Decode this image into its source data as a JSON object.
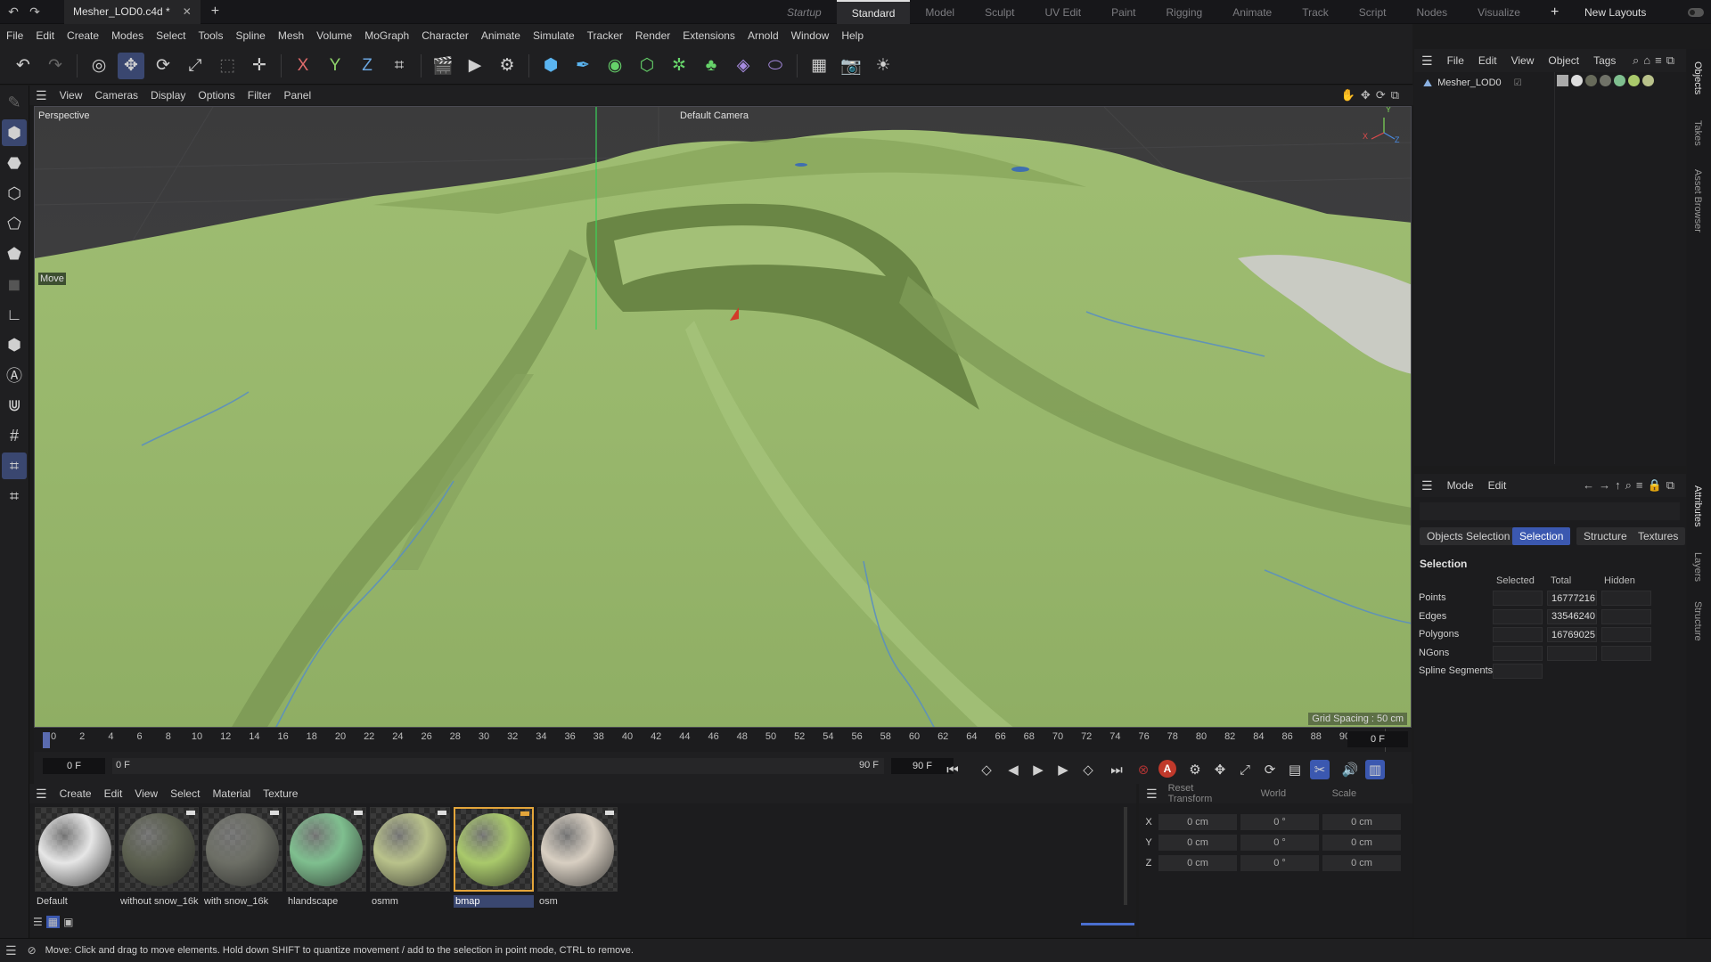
{
  "titlebar": {
    "document_tab": "Mesher_LOD0.c4d *",
    "layouts": [
      "Startup",
      "Standard",
      "Model",
      "Sculpt",
      "UV Edit",
      "Paint",
      "Rigging",
      "Animate",
      "Track",
      "Script",
      "Nodes",
      "Visualize"
    ],
    "active_layout": "Standard",
    "new_layouts": "New Layouts"
  },
  "menubar": [
    "File",
    "Edit",
    "Create",
    "Modes",
    "Select",
    "Tools",
    "Spline",
    "Mesh",
    "Volume",
    "MoGraph",
    "Character",
    "Animate",
    "Simulate",
    "Tracker",
    "Render",
    "Extensions",
    "Arnold",
    "Window",
    "Help"
  ],
  "toolbar": {
    "axis_x": "X",
    "axis_y": "Y",
    "axis_z": "Z"
  },
  "viewport": {
    "menu": [
      "View",
      "Cameras",
      "Display",
      "Options",
      "Filter",
      "Panel"
    ],
    "view_name": "Perspective",
    "camera": "Default Camera",
    "tool_label": "Move",
    "grid_spacing": "Grid Spacing : 50 cm",
    "axis_x": "X",
    "axis_y": "Y",
    "axis_z": "Z"
  },
  "timeline": {
    "ticks": [
      "0",
      "2",
      "4",
      "6",
      "8",
      "10",
      "12",
      "14",
      "16",
      "18",
      "20",
      "22",
      "24",
      "26",
      "28",
      "30",
      "32",
      "34",
      "36",
      "38",
      "40",
      "42",
      "44",
      "46",
      "48",
      "50",
      "52",
      "54",
      "56",
      "58",
      "60",
      "62",
      "64",
      "66",
      "68",
      "70",
      "72",
      "74",
      "76",
      "78",
      "80",
      "82",
      "84",
      "86",
      "88",
      "90"
    ],
    "current_frame": "0 F",
    "start_frame": "0 F",
    "range_start": "0 F",
    "range_end": "90 F",
    "end_frame": "90 F",
    "record_label": "A"
  },
  "materials": {
    "menu": [
      "Create",
      "Edit",
      "View",
      "Select",
      "Material",
      "Texture"
    ],
    "items": [
      {
        "name": "Default",
        "color": "#e6e6e6"
      },
      {
        "name": "without snow_16k",
        "color": "#5c6050"
      },
      {
        "name": "with snow_16k",
        "color": "#6d6f66"
      },
      {
        "name": "hlandscape",
        "color": "#7fbf8f"
      },
      {
        "name": "osmm",
        "color": "#b9c28b"
      },
      {
        "name": "bmap",
        "color": "#a9c96b"
      },
      {
        "name": "osm",
        "color": "#d8cfc2"
      }
    ],
    "selected": "bmap"
  },
  "coordinates": {
    "reset": "Reset Transform",
    "space": "World",
    "mode": "Scale",
    "rows": [
      {
        "axis": "X",
        "pos": "0 cm",
        "rot": "0 °",
        "scale": "0 cm"
      },
      {
        "axis": "Y",
        "pos": "0 cm",
        "rot": "0 °",
        "scale": "0 cm"
      },
      {
        "axis": "Z",
        "pos": "0 cm",
        "rot": "0 °",
        "scale": "0 cm"
      }
    ]
  },
  "objects_panel": {
    "menu": [
      "File",
      "Edit",
      "View",
      "Object",
      "Tags"
    ],
    "object_name": "Mesher_LOD0"
  },
  "attributes": {
    "menu": [
      "Mode",
      "Edit"
    ],
    "tabs": [
      "Objects Selection",
      "Selection",
      "Structure",
      "Textures"
    ],
    "active_tab": "Selection",
    "section": "Selection",
    "columns": [
      "Selected",
      "Total",
      "Hidden"
    ],
    "rows": [
      {
        "label": "Points",
        "selected": "",
        "total": "16777216",
        "hidden": ""
      },
      {
        "label": "Edges",
        "selected": "",
        "total": "33546240",
        "hidden": ""
      },
      {
        "label": "Polygons",
        "selected": "",
        "total": "16769025",
        "hidden": ""
      },
      {
        "label": "NGons",
        "selected": "",
        "total": "",
        "hidden": ""
      },
      {
        "label": "Spline Segments",
        "selected": "",
        "total": "",
        "hidden": ""
      }
    ]
  },
  "side_tabs": [
    "Objects",
    "Takes",
    "Asset Browser",
    "Attributes",
    "Layers",
    "Structure"
  ],
  "status": "Move: Click and drag to move elements. Hold down SHIFT to quantize movement / add to the selection in point mode, CTRL to remove."
}
